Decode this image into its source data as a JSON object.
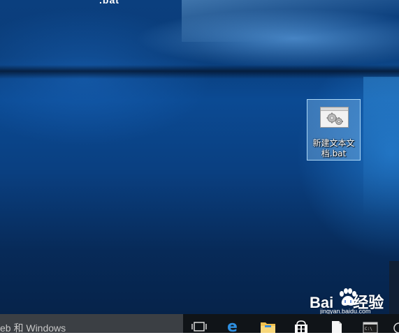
{
  "desktop": {
    "top_fragment": ".bat",
    "icons": [
      {
        "label": "新建文本文档.bat",
        "icon": "batch-file-gears-icon"
      }
    ]
  },
  "taskbar": {
    "search": {
      "text": "eb 和 Windows"
    },
    "buttons": [
      {
        "name": "task-view-icon"
      },
      {
        "name": "edge-icon"
      },
      {
        "name": "file-explorer-icon"
      },
      {
        "name": "store-icon"
      },
      {
        "name": "document-icon"
      },
      {
        "name": "terminal-icon"
      }
    ]
  },
  "watermark": {
    "brand_left": "Bai",
    "brand_right": "经验",
    "url": "jingyan.baidu.com",
    "icon": "baidu-paw-icon"
  },
  "colors": {
    "desktop_blue": "#0b4a93",
    "taskbar": "#101418",
    "search_box": "#3b3f44",
    "selection": "#99d1ff"
  }
}
